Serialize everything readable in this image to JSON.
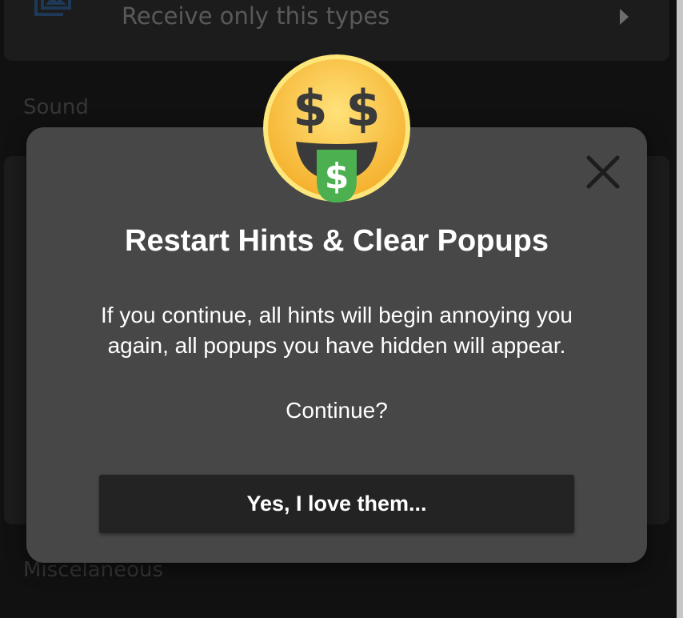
{
  "settings": {
    "receive_row": {
      "label": "Receive only this types",
      "icon": "image-library-icon",
      "chevron": "chevron-right-icon"
    },
    "sections": {
      "sound": "Sound",
      "misc": "Miscelaneous"
    }
  },
  "dialog": {
    "emoji": "money-mouth-face-icon",
    "emoji_symbol": "$",
    "close_icon": "close-icon",
    "title": "Restart Hints & Clear Popups",
    "message_line1": "If you continue, all hints will begin annoying you",
    "message_line2": "again, all popups you have hidden will appear.",
    "question": "Continue?",
    "confirm_label": "Yes, I love them..."
  },
  "colors": {
    "background": "#161616",
    "card": "#2b2b2b",
    "dialog": "#474747",
    "button": "#232323",
    "accent_icon": "#2f6fb3",
    "emoji_face": "#f7c23b",
    "emoji_dollar": "#3a3a3a",
    "emoji_tongue": "#4caf50"
  }
}
